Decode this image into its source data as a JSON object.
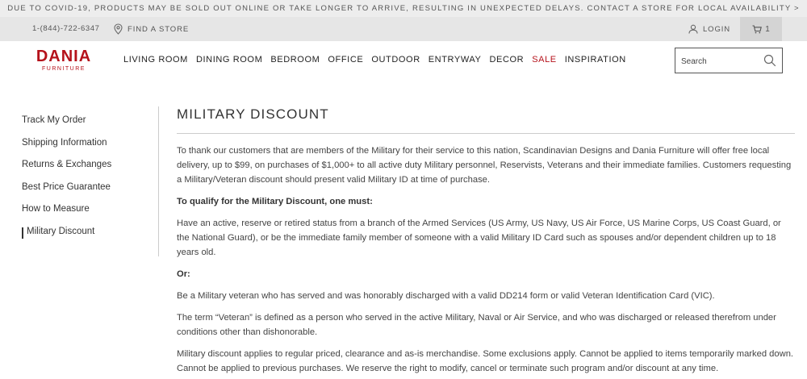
{
  "banner": {
    "text": "DUE TO COVID-19, PRODUCTS MAY BE SOLD OUT ONLINE OR TAKE LONGER TO ARRIVE, RESULTING IN UNEXPECTED DELAYS. CONTACT A STORE FOR LOCAL AVAILABILITY >"
  },
  "utility": {
    "phone": "1-(844)-722-6347",
    "find_store": "FIND A STORE",
    "login": "LOGIN",
    "cart_count": "1"
  },
  "brand": {
    "name": "DANIA",
    "sub": "FURNITURE",
    "color": "#b5121b"
  },
  "nav": {
    "items": [
      "LIVING ROOM",
      "DINING ROOM",
      "BEDROOM",
      "OFFICE",
      "OUTDOOR",
      "ENTRYWAY",
      "DECOR",
      "SALE",
      "INSPIRATION"
    ]
  },
  "search": {
    "placeholder": "Search"
  },
  "sidebar": {
    "items": [
      "Track My Order",
      "Shipping Information",
      "Returns & Exchanges",
      "Best Price Guarantee",
      "How to Measure",
      "Military Discount"
    ],
    "active": "Military Discount"
  },
  "content": {
    "title": "MILITARY DISCOUNT",
    "paragraphs": [
      "To thank our customers that are members of the Military for their service to this nation, Scandinavian Designs and Dania Furniture will offer free local delivery, up to $99, on purchases of $1,000+ to all active duty Military personnel, Reservists, Veterans and their immediate families. Customers requesting a Military/Veteran discount should present valid Military ID at time of purchase.",
      "To qualify for the Military Discount, one must:",
      "Have an active, reserve or retired status from a branch of the Armed Services (US Army, US Navy, US Air Force, US Marine Corps, US Coast Guard, or the National Guard), or be the immediate family member of someone with a valid Military ID Card such as spouses and/or dependent children up to 18 years old.",
      "Or:",
      "Be a Military veteran who has served and was honorably discharged with a valid DD214 form or valid Veteran Identification Card (VIC).",
      "The term “Veteran” is defined as a person who served in the active Military, Naval or Air Service, and who was discharged or released therefrom under conditions other than dishonorable.",
      "Military discount applies to regular priced, clearance and as-is merchandise. Some exclusions apply. Cannot be applied to items temporarily marked down. Cannot be applied to previous purchases. We reserve the right to modify, cancel or terminate such program and/or discount at any time."
    ]
  }
}
